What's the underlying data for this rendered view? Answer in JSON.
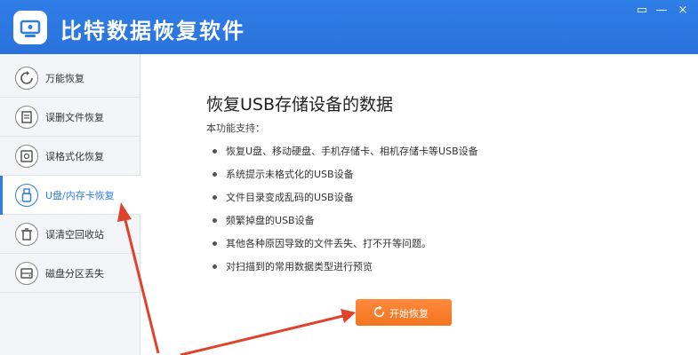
{
  "app": {
    "title": "比特数据恢复软件",
    "window_controls": [
      "▭",
      "—",
      "×"
    ]
  },
  "sidebar": {
    "items": [
      {
        "label": "万能恢复",
        "icon": "refresh-icon",
        "active": false
      },
      {
        "label": "误删文件恢复",
        "icon": "document-icon",
        "active": false
      },
      {
        "label": "误格式化恢复",
        "icon": "disk-icon",
        "active": false
      },
      {
        "label": "U盘/内存卡恢复",
        "icon": "usb-icon",
        "active": true
      },
      {
        "label": "误清空回收站",
        "icon": "trash-icon",
        "active": false
      },
      {
        "label": "磁盘分区丢失",
        "icon": "partition-icon",
        "active": false
      }
    ]
  },
  "main": {
    "heading": "恢复USB存储设备的数据",
    "subheading": "本功能支持：",
    "features": [
      "恢复U盘、移动硬盘、手机存储卡、相机存储卡等USB设备",
      "系统提示未格式化的USB设备",
      "文件目录变成乱码的USB设备",
      "频繁掉盘的USB设备",
      "其他各种原因导致的文件丢失、打不开等问题。",
      "对扫描到的常用数据类型进行预览"
    ],
    "start_button": "开始恢复"
  },
  "colors": {
    "titlebar": "#2f7ee6",
    "accent": "#2f7ee6",
    "button": "#f3741f",
    "annotation_arrow": "#e0432b"
  }
}
